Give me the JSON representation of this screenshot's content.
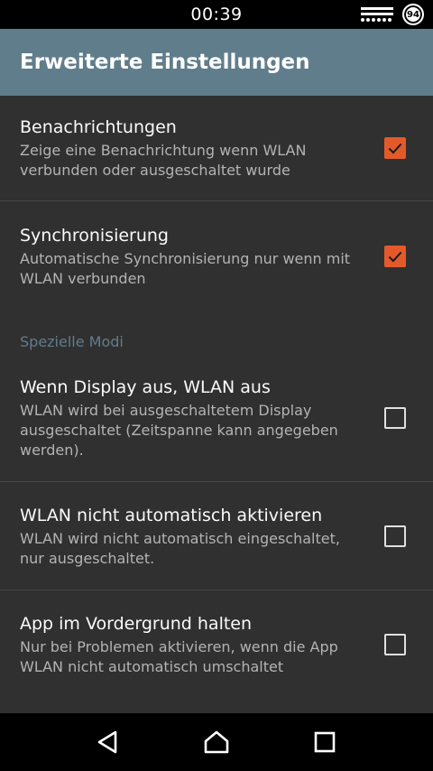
{
  "status": {
    "time": "00:39",
    "battery": "94"
  },
  "app_bar": {
    "title": "Erweiterte Einstellungen"
  },
  "prefs": [
    {
      "title": "Benachrichtungen",
      "summary": "Zeige eine Benachrichtung wenn WLAN verbunden oder ausgeschaltet wurde",
      "checked": true
    },
    {
      "title": "Synchronisierung",
      "summary": "Automatische Synchronisierung nur wenn mit WLAN verbunden",
      "checked": true
    },
    {
      "title": "Wenn Display aus, WLAN aus",
      "summary": "WLAN wird bei ausgeschaltetem Display ausgeschaltet (Zeitspanne kann angegeben werden).",
      "checked": false
    },
    {
      "title": "WLAN nicht automatisch aktivieren",
      "summary": "WLAN wird nicht automatisch eingeschaltet, nur ausgeschaltet.",
      "checked": false
    },
    {
      "title": "App im Vordergrund halten",
      "summary": "Nur bei Problemen aktivieren, wenn die App WLAN nicht automatisch umschaltet",
      "checked": false
    }
  ],
  "category": {
    "label": "Spezielle Modi"
  },
  "colors": {
    "accent": "#e35a2a",
    "app_bar": "#607d8b",
    "background": "#303030"
  },
  "icons": {
    "status": [
      "wifi-icon",
      "battery-icon"
    ],
    "nav": [
      "back-icon",
      "home-icon",
      "recents-icon"
    ],
    "checkbox_checked": "check-icon"
  }
}
